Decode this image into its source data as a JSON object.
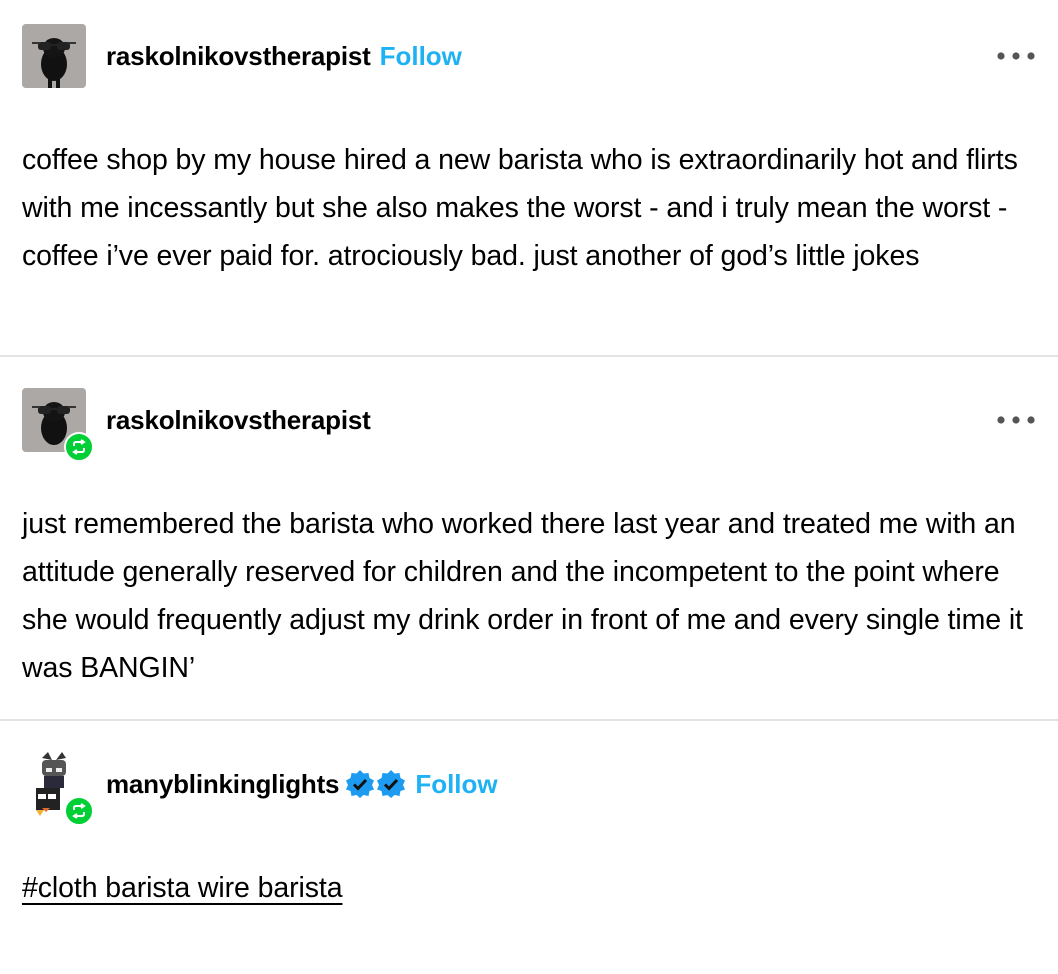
{
  "posts": [
    {
      "username": "raskolnikovstherapist",
      "follow_label": "Follow",
      "body": "coffee shop by my house hired a new barista who is extraordinarily hot and flirts with me incessantly but she also makes the worst - and i truly mean the worst - coffee i’ve ever paid for. atrociously bad. just another of god’s little jokes"
    },
    {
      "username": "raskolnikovstherapist",
      "body": "just remembered the barista who worked there last year and treated me with an attitude generally reserved for children and the incompetent to the point where she would frequently adjust my drink order in front of me and every single time it was BANGIN’"
    },
    {
      "username": "manyblinkinglights",
      "follow_label": "Follow",
      "tag": "#cloth barista wire barista"
    }
  ],
  "icons": {
    "more": "ellipsis-icon",
    "reblog": "reblog-icon",
    "verified": "verified-badge-icon"
  },
  "colors": {
    "follow": "#1eb1f3",
    "reblog_badge": "#00cf35",
    "verified": "#1d9bf0",
    "divider": "#e3e3e3"
  }
}
